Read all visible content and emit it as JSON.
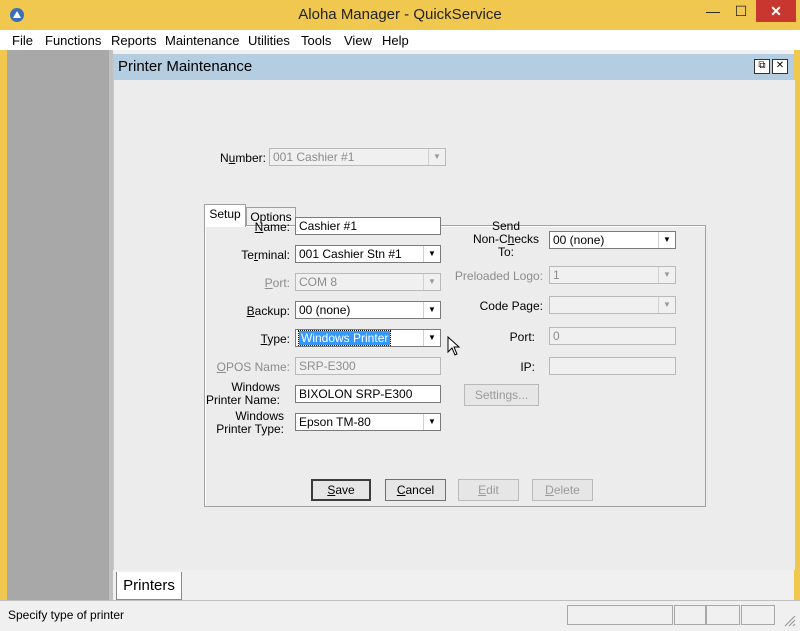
{
  "window": {
    "title": "Aloha Manager - QuickService",
    "minimize": "—",
    "maximize": "☐",
    "close": "✕"
  },
  "menu": [
    "File",
    "Functions",
    "Reports",
    "Maintenance",
    "Utilities",
    "Tools",
    "View",
    "Help"
  ],
  "child": {
    "title": "Printer Maintenance",
    "restore": "⧉",
    "close": "✕"
  },
  "number": {
    "label_pre": "N",
    "label_u": "u",
    "label_post": "mber:",
    "value": "001 Cashier #1"
  },
  "tabs": {
    "setup": "Setup",
    "options": "Options"
  },
  "form": {
    "name": {
      "label_u": "N",
      "label_post": "ame:",
      "value": "Cashier #1"
    },
    "terminal": {
      "label_pre": "Te",
      "label_u": "r",
      "label_post": "minal:",
      "value": "001 Cashier Stn #1"
    },
    "port": {
      "label_u": "P",
      "label_post": "ort:",
      "value": "COM 8"
    },
    "backup": {
      "label_u": "B",
      "label_post": "ackup:",
      "value": "00  (none)"
    },
    "type": {
      "label_u": "T",
      "label_post": "ype:",
      "value": "Windows Printer"
    },
    "opos_name": {
      "label_u": "O",
      "label_post": "POS Name:",
      "value": "SRP-E300"
    },
    "windows_printer_name": {
      "label_line1": "Windows",
      "label_line2": "Printer Name:",
      "value": "BIXOLON SRP-E300"
    },
    "windows_printer_type": {
      "label_line1": "Windows",
      "label_line2": "Printer Type:",
      "value": "Epson TM-80"
    },
    "send_non_checks": {
      "label_line1": "Send",
      "label_line2_pre": "Non-C",
      "label_line2_u": "h",
      "label_line2_post": "ecks",
      "label_line3": "To:",
      "value": "00  (none)"
    },
    "preloaded_logo": {
      "label": "Preloaded Logo:",
      "value": "1"
    },
    "code_page": {
      "label": "Code Page:",
      "value": ""
    },
    "net_port": {
      "label": "Port:",
      "value": "0"
    },
    "ip": {
      "label": "IP:",
      "value": ""
    },
    "settings_button": "Settings..."
  },
  "buttons": {
    "save": {
      "u": "S",
      "post": "ave"
    },
    "cancel": {
      "u": "C",
      "post": "ancel"
    },
    "edit": {
      "u": "E",
      "post": "dit"
    },
    "delete": {
      "u": "D",
      "post": "elete"
    }
  },
  "bottom_tab": "Printers",
  "status": {
    "text": "Specify type of printer"
  },
  "colors": {
    "title_bar": "#f0c850",
    "child_title": "#b5cde1",
    "selection": "#3399ff",
    "close_button": "#c7372f"
  }
}
